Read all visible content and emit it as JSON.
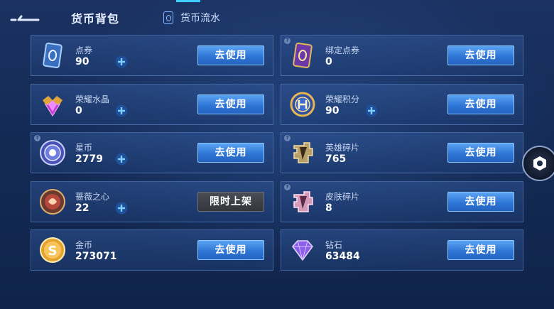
{
  "header": {
    "title": "货币背包",
    "history_label": "货币流水"
  },
  "colors": {
    "use_button": "#2f76d6",
    "limited_button": "#3a3d44",
    "card_bg": "#244a8a",
    "accent": "#3fd0ff"
  },
  "currencies": [
    {
      "name": "点券",
      "amount": "90",
      "button": "去使用",
      "icon": "coupon-icon"
    },
    {
      "name": "绑定点券",
      "amount": "0",
      "button": "去使用",
      "icon": "bound-coupon-icon"
    },
    {
      "name": "荣耀水晶",
      "amount": "0",
      "button": "去使用",
      "icon": "glory-crystal-icon"
    },
    {
      "name": "荣耀积分",
      "amount": "90",
      "button": "去使用",
      "icon": "glory-points-icon"
    },
    {
      "name": "星币",
      "amount": "2779",
      "button": "去使用",
      "icon": "star-coin-icon"
    },
    {
      "name": "英雄碎片",
      "amount": "765",
      "button": "去使用",
      "icon": "hero-fragment-icon"
    },
    {
      "name": "蔷薇之心",
      "amount": "22",
      "button": "限时上架",
      "icon": "rose-heart-icon"
    },
    {
      "name": "皮肤碎片",
      "amount": "8",
      "button": "去使用",
      "icon": "skin-fragment-icon"
    },
    {
      "name": "金币",
      "amount": "273071",
      "button": "去使用",
      "icon": "gold-coin-icon"
    },
    {
      "name": "钻石",
      "amount": "63484",
      "button": "去使用",
      "icon": "diamond-icon"
    }
  ]
}
